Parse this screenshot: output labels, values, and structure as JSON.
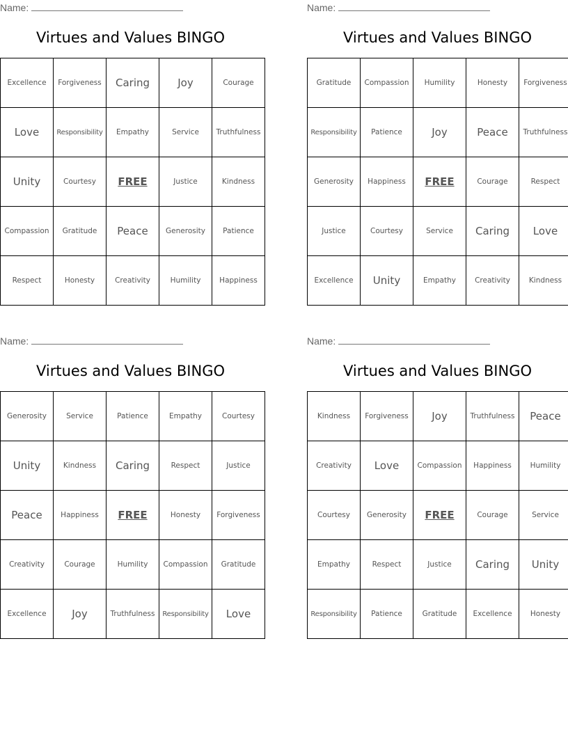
{
  "page": {
    "name_label": "Name:",
    "title": "Virtues and Values BINGO",
    "free_label": "FREE"
  },
  "cards": [
    {
      "cells": [
        [
          "Excellence",
          "Forgiveness",
          "Caring",
          "Joy",
          "Courage"
        ],
        [
          "Love",
          "Responsibility",
          "Empathy",
          "Service",
          "Truthfulness"
        ],
        [
          "Unity",
          "Courtesy",
          "FREE",
          "Justice",
          "Kindness"
        ],
        [
          "Compassion",
          "Gratitude",
          "Peace",
          "Generosity",
          "Patience"
        ],
        [
          "Respect",
          "Honesty",
          "Creativity",
          "Humility",
          "Happiness"
        ]
      ]
    },
    {
      "cells": [
        [
          "Gratitude",
          "Compassion",
          "Humility",
          "Honesty",
          "Forgiveness"
        ],
        [
          "Responsibility",
          "Patience",
          "Joy",
          "Peace",
          "Truthfulness"
        ],
        [
          "Generosity",
          "Happiness",
          "FREE",
          "Courage",
          "Respect"
        ],
        [
          "Justice",
          "Courtesy",
          "Service",
          "Caring",
          "Love"
        ],
        [
          "Excellence",
          "Unity",
          "Empathy",
          "Creativity",
          "Kindness"
        ]
      ]
    },
    {
      "cells": [
        [
          "Generosity",
          "Service",
          "Patience",
          "Empathy",
          "Courtesy"
        ],
        [
          "Unity",
          "Kindness",
          "Caring",
          "Respect",
          "Justice"
        ],
        [
          "Peace",
          "Happiness",
          "FREE",
          "Honesty",
          "Forgiveness"
        ],
        [
          "Creativity",
          "Courage",
          "Humility",
          "Compassion",
          "Gratitude"
        ],
        [
          "Excellence",
          "Joy",
          "Truthfulness",
          "Responsibility",
          "Love"
        ]
      ]
    },
    {
      "cells": [
        [
          "Kindness",
          "Forgiveness",
          "Joy",
          "Truthfulness",
          "Peace"
        ],
        [
          "Creativity",
          "Love",
          "Compassion",
          "Happiness",
          "Humility"
        ],
        [
          "Courtesy",
          "Generosity",
          "FREE",
          "Courage",
          "Service"
        ],
        [
          "Empathy",
          "Respect",
          "Justice",
          "Caring",
          "Unity"
        ],
        [
          "Responsibility",
          "Patience",
          "Gratitude",
          "Excellence",
          "Honesty"
        ]
      ]
    }
  ]
}
